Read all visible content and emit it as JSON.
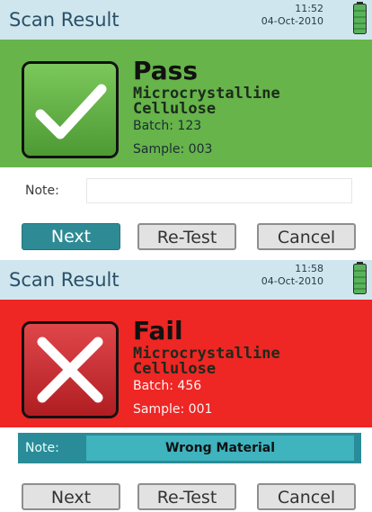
{
  "screens": [
    {
      "title": "Scan Result",
      "time": "11:52",
      "date": "04-Oct-2010",
      "status": "Pass",
      "status_icon": "checkmark-icon",
      "material_line1": "Microcrystalline",
      "material_line2": "Cellulose",
      "batch": "Batch: 123",
      "sample": "Sample: 003",
      "note_label": "Note:",
      "note_value": "",
      "buttons": {
        "next": "Next",
        "retest": "Re-Test",
        "cancel": "Cancel"
      },
      "accent_color": "#66b44a"
    },
    {
      "title": "Scan Result",
      "time": "11:58",
      "date": "04-Oct-2010",
      "status": "Fail",
      "status_icon": "cross-icon",
      "material_line1": "Microcrystalline",
      "material_line2": "Cellulose",
      "batch": "Batch: 456",
      "sample": "Sample: 001",
      "note_label": "Note:",
      "note_value": "Wrong Material",
      "buttons": {
        "next": "Next",
        "retest": "Re-Test",
        "cancel": "Cancel"
      },
      "accent_color": "#ee2624"
    }
  ],
  "colors": {
    "title_bar": "#cfe6ee",
    "primary_button": "#2e8b96",
    "note_teal": "#2a8c98",
    "battery": "#57b45a"
  }
}
